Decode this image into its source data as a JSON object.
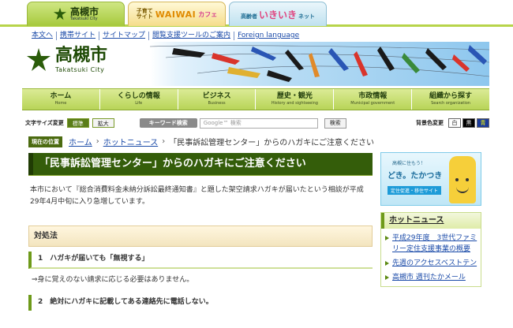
{
  "site_tabs": {
    "tab1": {
      "main": "高槻市",
      "sub": "Takatsuki City"
    },
    "tab2": {
      "small_line1": "子育て",
      "small_line2": "サイト",
      "main": "WAIWAI",
      "suffix": "カフェ"
    },
    "tab3": {
      "prefix": "高齢者",
      "main": "いきいき",
      "suffix": "ネット"
    }
  },
  "utility_nav": [
    "本文へ",
    "携帯サイト",
    "サイトマップ",
    "閲覧支援ツールのご案内",
    "Foreign language"
  ],
  "logo": {
    "name": "高槻市",
    "sub": "Takatsuki City"
  },
  "main_nav": [
    {
      "ja": "ホーム",
      "en": "Home"
    },
    {
      "ja": "くらしの情報",
      "en": "Life"
    },
    {
      "ja": "ビジネス",
      "en": "Business"
    },
    {
      "ja": "歴史・観光",
      "en": "History and sightseeing"
    },
    {
      "ja": "市政情報",
      "en": "Municipal government"
    },
    {
      "ja": "組織から探す",
      "en": "Search organization"
    }
  ],
  "toolbar": {
    "font_size_label": "文字サイズ変更",
    "standard": "標準",
    "enlarge": "拡大",
    "keyword_label": "キーワード検索",
    "search_placeholder": "Google™ 検索",
    "search_button": "検索",
    "bg_label": "背景色変更",
    "colors": [
      "白",
      "黒",
      "青"
    ]
  },
  "breadcrumb": {
    "here": "現在の位置",
    "items": [
      "ホーム",
      "ホットニュース",
      "「民事訴訟管理センター」からのハガキにご注意ください"
    ]
  },
  "article": {
    "title": "「民事訴訟管理センター」からのハガキにご注意ください",
    "lead": "本市において『総合消費料金未納分訴訟最終通知書』と題した架空請求ハガキが届いたという相談が平成29年4月中旬に入り急増しています。",
    "section_title": "対処法",
    "item1_title": "1　ハガキが届いても「無視する」",
    "item1_body": "⇒身に覚えのない請求に応じる必要はありません。",
    "item2_title": "2　絶対にハガキに記載してある連絡先に電話しない。"
  },
  "side": {
    "promo": {
      "small": "高槻に住もう！",
      "main": "どき。たかつき",
      "tag": "定住促進・移住サイト"
    },
    "hot_title": "ホットニュース",
    "hot_items": [
      "平成29年度　3世代ファミリー定住支援事業の概要",
      "先週のアクセスベストテン",
      "高槻市 週刊たかメール"
    ]
  },
  "colors": {
    "green_dark": "#345d0a",
    "green_nav": "#b8d457",
    "link": "#1a4aa8"
  }
}
